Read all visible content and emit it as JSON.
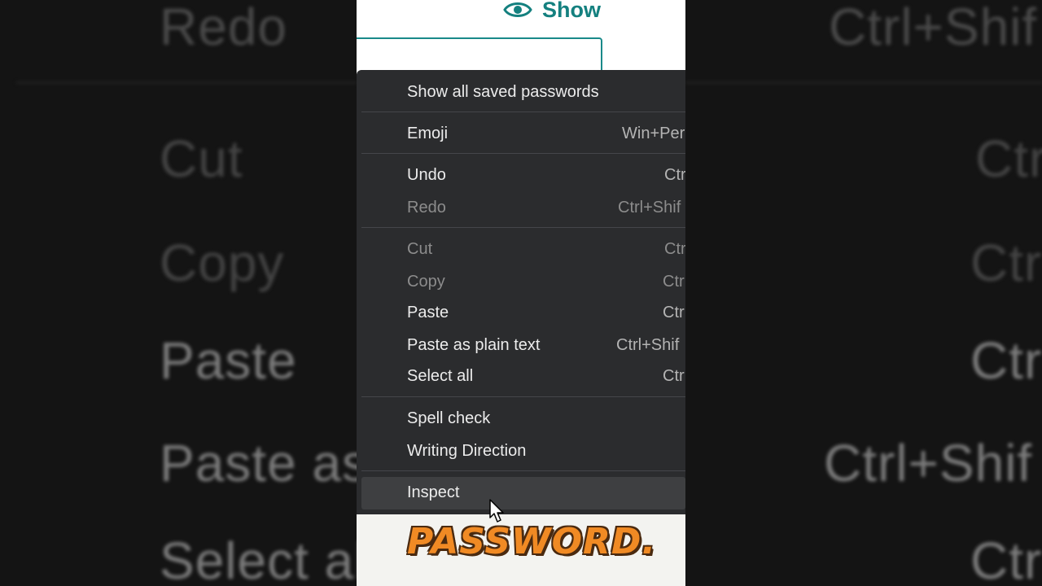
{
  "background": {
    "left": [
      "Redo",
      "Cut",
      "Copy",
      "Paste",
      "Paste as",
      "Select al"
    ],
    "right": [
      "Ctrl+Shif",
      "Ctr",
      "Ctr",
      "Ctr",
      "Ctrl+Shif",
      "Ctr"
    ]
  },
  "page": {
    "show_label": "Show",
    "caption": "PASSWORD."
  },
  "menu": {
    "items": [
      {
        "label": "Show all saved passwords",
        "shortcut": ""
      },
      {
        "label": "Emoji",
        "shortcut": "Win+Per"
      },
      {
        "label": "Undo",
        "shortcut": "Ctr"
      },
      {
        "label": "Redo",
        "shortcut": "Ctrl+Shif"
      },
      {
        "label": "Cut",
        "shortcut": "Ctr"
      },
      {
        "label": "Copy",
        "shortcut": "Ctr"
      },
      {
        "label": "Paste",
        "shortcut": "Ctr"
      },
      {
        "label": "Paste as plain text",
        "shortcut": "Ctrl+Shif"
      },
      {
        "label": "Select all",
        "shortcut": "Ctr"
      },
      {
        "label": "Spell check",
        "shortcut": ""
      },
      {
        "label": "Writing Direction",
        "shortcut": ""
      },
      {
        "label": "Inspect",
        "shortcut": ""
      }
    ]
  },
  "colors": {
    "accent": "#14807f",
    "menu_bg": "#2b2c2e",
    "caption": "#f08a24"
  }
}
